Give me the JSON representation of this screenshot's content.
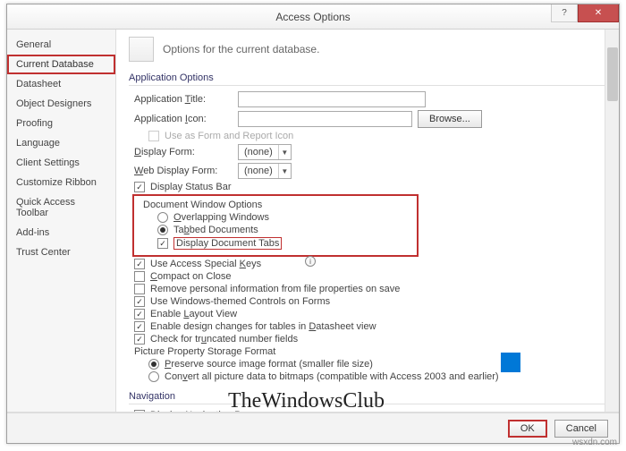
{
  "window": {
    "title": "Access Options",
    "help": "?",
    "close": "✕"
  },
  "sidebar": {
    "items": [
      "General",
      "Current Database",
      "Datasheet",
      "Object Designers",
      "Proofing",
      "Language",
      "Client Settings",
      "Customize Ribbon",
      "Quick Access Toolbar",
      "Add-ins",
      "Trust Center"
    ],
    "selected_index": 1
  },
  "header": {
    "text": "Options for the current database."
  },
  "groups": {
    "app_options": "Application Options",
    "navigation": "Navigation"
  },
  "fields": {
    "app_title": {
      "label": "Application Title:",
      "value": ""
    },
    "app_icon": {
      "label": "Application Icon:",
      "value": "",
      "browse": "Browse..."
    },
    "use_icon": "Use as Form and Report Icon",
    "display_form": {
      "label": "Display Form:",
      "value": "(none)"
    },
    "web_display_form": {
      "label": "Web Display Form:",
      "value": "(none)"
    }
  },
  "checks": {
    "status_bar": {
      "label": "Display Status Bar",
      "checked": true
    },
    "doc_win": "Document Window Options",
    "overlap": {
      "label": "Overlapping Windows",
      "selected": false
    },
    "tabbed": {
      "label": "Tabbed Documents",
      "selected": true
    },
    "doc_tabs": {
      "label": "Display Document Tabs",
      "checked": true
    },
    "special_keys": {
      "label": "Use Access Special Keys",
      "checked": true
    },
    "compact": {
      "label": "Compact on Close",
      "checked": false
    },
    "remove_pi": {
      "label": "Remove personal information from file properties on save",
      "checked": false
    },
    "themed": {
      "label": "Use Windows-themed Controls on Forms",
      "checked": true
    },
    "layout_view": {
      "label": "Enable Layout View",
      "checked": true
    },
    "design_changes": {
      "label": "Enable design changes for tables in Datasheet view",
      "checked": true
    },
    "truncated": {
      "label": "Check for truncated number fields",
      "checked": true
    },
    "pic_storage": "Picture Property Storage Format",
    "preserve": {
      "label": "Preserve source image format (smaller file size)",
      "selected": true
    },
    "convert": {
      "label": "Convert all picture data to bitmaps (compatible with Access 2003 and earlier)",
      "selected": false
    },
    "nav_pane": {
      "label": "Display Navigation Pane",
      "checked": true
    }
  },
  "footer": {
    "ok": "OK",
    "cancel": "Cancel"
  },
  "watermark": "TheWindowsClub",
  "url": "wsxdn.com"
}
